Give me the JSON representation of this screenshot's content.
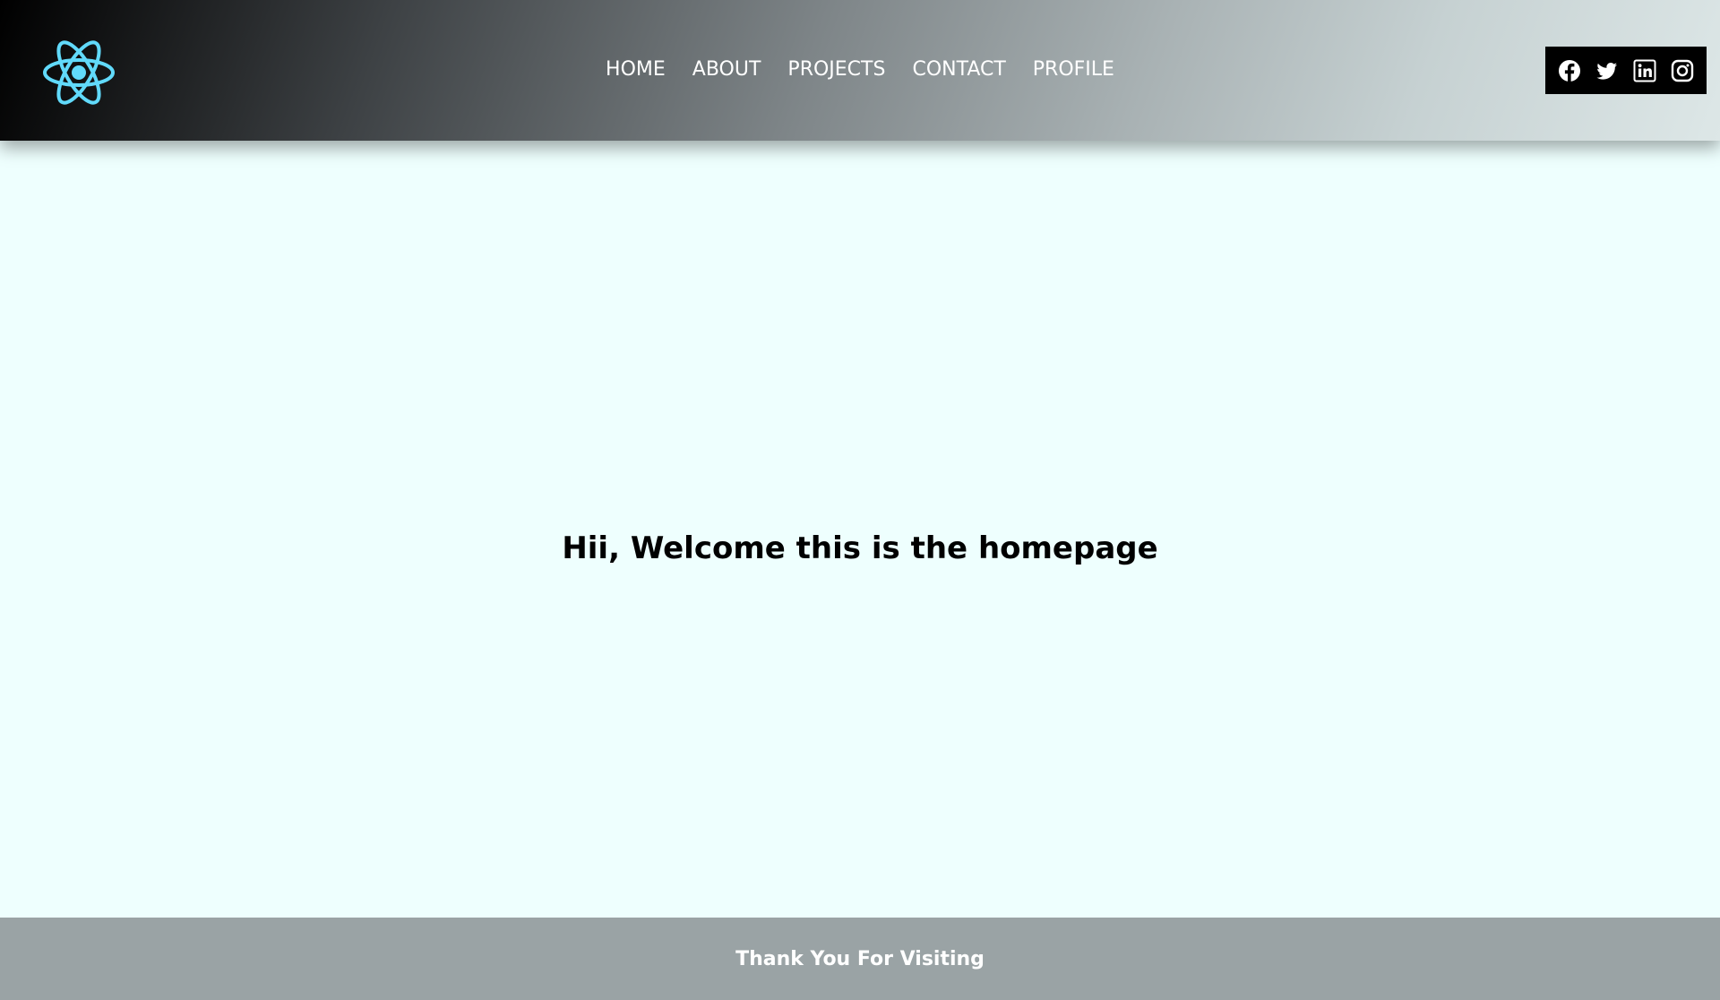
{
  "header": {
    "logo_icon": "react-atom-icon",
    "logo_color": "#61dafb",
    "nav": [
      {
        "label": "HOME"
      },
      {
        "label": "ABOUT"
      },
      {
        "label": "PROJECTS"
      },
      {
        "label": "CONTACT"
      },
      {
        "label": "PROFILE"
      }
    ],
    "social": [
      {
        "icon": "facebook-icon"
      },
      {
        "icon": "twitter-icon"
      },
      {
        "icon": "linkedin-icon"
      },
      {
        "icon": "instagram-icon"
      }
    ]
  },
  "main": {
    "headline": "Hii, Welcome this is the homepage"
  },
  "footer": {
    "text": "Thank You For Visiting"
  },
  "colors": {
    "page_background": "#eefffe",
    "footer_background": "#9aa3a5",
    "social_background": "#000000",
    "nav_text": "#ffffff"
  }
}
